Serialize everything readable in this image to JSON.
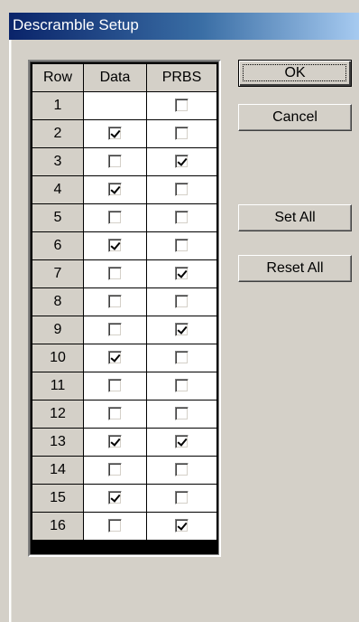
{
  "window": {
    "title": "Descramble Setup"
  },
  "grid": {
    "headers": [
      "Row",
      "Data",
      "PRBS"
    ],
    "rows": [
      {
        "row": "1",
        "data": null,
        "prbs": false
      },
      {
        "row": "2",
        "data": true,
        "prbs": false
      },
      {
        "row": "3",
        "data": false,
        "prbs": true
      },
      {
        "row": "4",
        "data": true,
        "prbs": false
      },
      {
        "row": "5",
        "data": false,
        "prbs": false
      },
      {
        "row": "6",
        "data": true,
        "prbs": false
      },
      {
        "row": "7",
        "data": false,
        "prbs": true
      },
      {
        "row": "8",
        "data": false,
        "prbs": false
      },
      {
        "row": "9",
        "data": false,
        "prbs": true
      },
      {
        "row": "10",
        "data": true,
        "prbs": false
      },
      {
        "row": "11",
        "data": false,
        "prbs": false
      },
      {
        "row": "12",
        "data": false,
        "prbs": false
      },
      {
        "row": "13",
        "data": true,
        "prbs": true
      },
      {
        "row": "14",
        "data": false,
        "prbs": false
      },
      {
        "row": "15",
        "data": true,
        "prbs": false
      },
      {
        "row": "16",
        "data": false,
        "prbs": true
      }
    ]
  },
  "buttons": {
    "ok": "OK",
    "cancel": "Cancel",
    "set_all": "Set All",
    "reset_all": "Reset All"
  },
  "colors": {
    "title_gradient_start": "#0a246a",
    "title_gradient_end": "#a6caf0",
    "face": "#d4d0c8"
  }
}
